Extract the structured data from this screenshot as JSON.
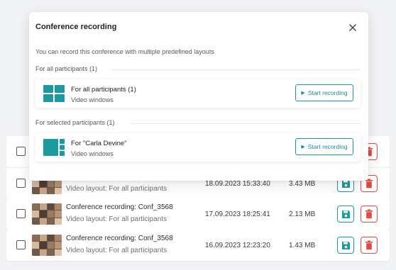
{
  "modal": {
    "title": "Conference recording",
    "description": "You can record this conference with multiple predefined layouts",
    "sections": [
      {
        "label": "For all participants (1)",
        "card": {
          "name": "For all participants (1)",
          "sub": "Video windows",
          "button": "Start recording"
        }
      },
      {
        "label": "For selected participants (1)",
        "card": {
          "name": "For \"Carla Devine\"",
          "sub": "Video windows",
          "button": "Start recording"
        }
      }
    ]
  },
  "recordings": [
    {
      "name": "",
      "sub": "",
      "date": "",
      "size": ""
    },
    {
      "name": "",
      "sub": "Video layout: For all participants",
      "date": "18.09.2023 15:33:40",
      "size": "3.43 MB"
    },
    {
      "name": "Conference recording: Conf_3568",
      "sub": "Video layout: For all participants",
      "date": "17.09.2023 18:25:41",
      "size": "2.13 MB"
    },
    {
      "name": "Conference recording: Conf_3568",
      "sub": "Video layout: For all participants",
      "date": "16.09.2023 12:23:20",
      "size": "1.43 MB"
    }
  ],
  "colors": {
    "accent": "#1a9aa0",
    "danger": "#e04a3f",
    "background": "#f2f3f5"
  },
  "icons": {
    "close": "close-icon",
    "save": "save-icon",
    "delete": "trash-icon",
    "layout_grid": "grid-layout-icon",
    "layout_focus": "focus-layout-icon"
  }
}
